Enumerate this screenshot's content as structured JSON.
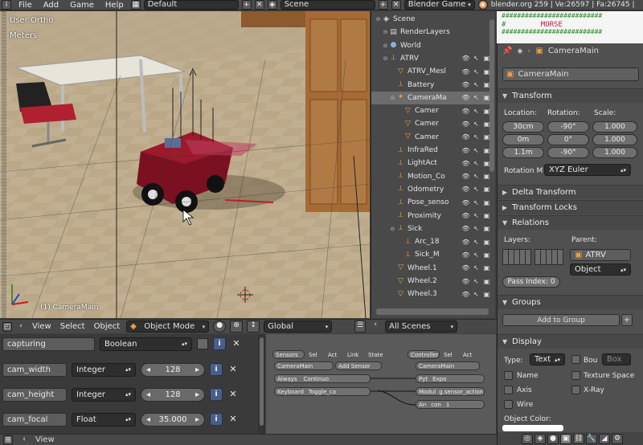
{
  "topbar": {
    "menus": [
      "File",
      "Add",
      "Game",
      "Help"
    ],
    "screen_layout": "Default",
    "scene": "Scene",
    "engine": "Blender Game",
    "info": "blender.org 259 | Ve:26597 | Fa:26745 |"
  },
  "viewport": {
    "view_label": "User Ortho",
    "unit_label": "Meters",
    "object_label": "(1) CameraMain"
  },
  "outliner": {
    "rows": [
      {
        "label": "Scene",
        "icon": "scene-icon",
        "indent": 0,
        "vis": false
      },
      {
        "label": "RenderLayers",
        "icon": "renderlayers-icon",
        "indent": 1,
        "vis": false
      },
      {
        "label": "World",
        "icon": "world-icon",
        "indent": 1,
        "vis": false
      },
      {
        "label": "ATRV",
        "icon": "empty-icon",
        "indent": 1,
        "vis": true
      },
      {
        "label": "ATRV_Mesl",
        "icon": "mesh-icon",
        "indent": 2,
        "vis": true
      },
      {
        "label": "Battery",
        "icon": "empty-icon",
        "indent": 2,
        "vis": true
      },
      {
        "label": "CameraMa",
        "icon": "camera-object-icon",
        "indent": 2,
        "vis": true,
        "selected": true
      },
      {
        "label": "Camer",
        "icon": "camera-icon",
        "indent": 3,
        "vis": true
      },
      {
        "label": "Camer",
        "icon": "camera-icon",
        "indent": 3,
        "vis": true
      },
      {
        "label": "Camer",
        "icon": "camera-icon",
        "indent": 3,
        "vis": true
      },
      {
        "label": "InfraRed",
        "icon": "empty-icon",
        "indent": 2,
        "vis": true
      },
      {
        "label": "LightAct",
        "icon": "empty-icon",
        "indent": 2,
        "vis": true
      },
      {
        "label": "Motion_Co",
        "icon": "empty-icon",
        "indent": 2,
        "vis": true
      },
      {
        "label": "Odometry",
        "icon": "empty-icon",
        "indent": 2,
        "vis": true
      },
      {
        "label": "Pose_senso",
        "icon": "empty-icon",
        "indent": 2,
        "vis": true
      },
      {
        "label": "Proximity",
        "icon": "empty-icon",
        "indent": 2,
        "vis": true
      },
      {
        "label": "Sick",
        "icon": "empty-icon",
        "indent": 2,
        "vis": true
      },
      {
        "label": "Arc_18",
        "icon": "empty-icon",
        "indent": 3,
        "vis": true
      },
      {
        "label": "Sick_M",
        "icon": "empty-icon",
        "indent": 3,
        "vis": true
      },
      {
        "label": "Wheel.1",
        "icon": "mesh-icon",
        "indent": 2,
        "vis": true
      },
      {
        "label": "Wheel.2",
        "icon": "mesh-icon",
        "indent": 2,
        "vis": true
      },
      {
        "label": "Wheel.3",
        "icon": "mesh-icon",
        "indent": 2,
        "vis": true
      }
    ],
    "header": {
      "filter": "All Scenes"
    }
  },
  "view3d_header": {
    "menus": [
      "View",
      "Select",
      "Object"
    ],
    "mode": "Object Mode",
    "orientation": "Global"
  },
  "game_props": [
    {
      "name": "capturing",
      "type": "Boolean",
      "value": ""
    },
    {
      "name": "cam_width",
      "type": "Integer",
      "value": "128"
    },
    {
      "name": "cam_height",
      "type": "Integer",
      "value": "128"
    },
    {
      "name": "cam_focal",
      "type": "Float",
      "value": "35.000"
    }
  ],
  "logic": {
    "sensors_label": "Sensors",
    "controller_label": "Controller",
    "filters": [
      "Sel",
      "Act",
      "Link",
      "State"
    ],
    "ctrl_filters": [
      "Sel",
      "Act"
    ],
    "object_name": "CameraMain",
    "add_sensor": "Add Sensor",
    "sensor1": "Always",
    "sensor1_b": "Continuo",
    "sensor2": "Keyboard",
    "sensor2_b": "Toggle_ca",
    "ctrl1": "Pyt",
    "ctrl1_b": "Expo",
    "ctrl2": "Modul",
    "ctrl2_b": "g.sensor_action",
    "ctrl3": "An",
    "ctrl3_b": "con",
    "ctrl3_c": "1",
    "ctrl_object": "CameraMain"
  },
  "bottombar": {
    "view": "View"
  },
  "info_panel": {
    "banner": "MORSE"
  },
  "properties": {
    "object_name": "CameraMain",
    "breadcrumb": "CameraMain",
    "transform": {
      "title": "Transform",
      "location_label": "Location:",
      "rotation_label": "Rotation:",
      "scale_label": "Scale:",
      "location": [
        "30cm",
        "0m",
        "1.1m"
      ],
      "rotation": [
        "-90°",
        "0°",
        "-90°"
      ],
      "scale": [
        "1.000",
        "1.000",
        "1.000"
      ],
      "rotation_mode_label": "Rotation M",
      "rotation_mode": "XYZ Euler"
    },
    "delta_transform": "Delta Transform",
    "transform_locks": "Transform Locks",
    "relations": {
      "title": "Relations",
      "layers_label": "Layers:",
      "parent_label": "Parent:",
      "parent": "ATRV",
      "parent_type": "Object",
      "pass_index": "Pass Index: 0"
    },
    "groups": {
      "title": "Groups",
      "add_to_group": "Add to Group"
    },
    "display": {
      "title": "Display",
      "type_label": "Type:",
      "type": "Text",
      "bounds_label": "Bou",
      "bounds_type": "Box",
      "name_label": "Name",
      "texture_space_label": "Texture Space",
      "axis_label": "Axis",
      "xray_label": "X-Ray",
      "wire_label": "Wire",
      "object_color_label": "Object Color:"
    }
  }
}
